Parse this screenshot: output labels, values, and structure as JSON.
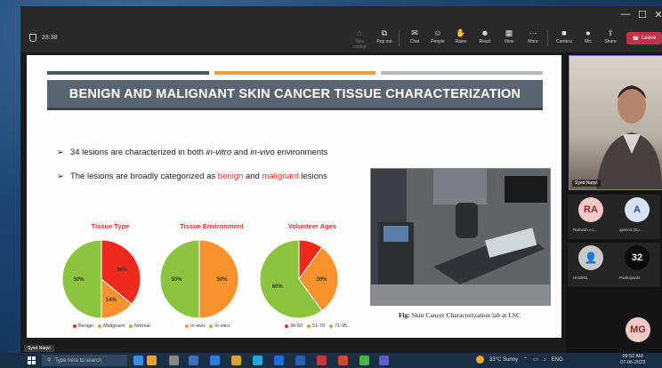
{
  "titlebar": {
    "minimize": "—",
    "maximize": "☐",
    "close": "✕"
  },
  "meeting": {
    "timer": "28:38",
    "toolbar": [
      {
        "label": "Take control",
        "icon": "take-control-icon",
        "dim": true
      },
      {
        "label": "Pop out",
        "icon": "pop-out-icon",
        "dim": false
      },
      {
        "label": "Chat",
        "icon": "chat-icon",
        "dim": false
      },
      {
        "label": "People",
        "icon": "people-icon",
        "dim": false
      },
      {
        "label": "Raise",
        "icon": "raise-hand-icon",
        "dim": false
      },
      {
        "label": "React",
        "icon": "react-icon",
        "dim": false
      },
      {
        "label": "View",
        "icon": "view-icon",
        "dim": false
      },
      {
        "label": "More",
        "icon": "more-icon",
        "dim": false
      },
      {
        "label": "Camera",
        "icon": "camera-icon",
        "dim": false
      },
      {
        "label": "Mic",
        "icon": "mic-icon",
        "dim": false
      },
      {
        "label": "Share",
        "icon": "share-icon",
        "dim": false
      }
    ],
    "leave_label": "Leave"
  },
  "slide": {
    "title": "BENIGN AND MALIGNANT SKIN CANCER TISSUE CHARACTERIZATION",
    "bullet1_a": "34 lesions are characterized in both ",
    "bullet1_b": "in-vitro",
    "bullet1_c": " and ",
    "bullet1_d": "in-vivo",
    "bullet1_e": " environments",
    "bullet2_a": "The lesions are broadly categorized as ",
    "bullet2_b": "benign",
    "bullet2_c": " and ",
    "bullet2_d": "malignant",
    "bullet2_e": " lesions",
    "caption_bold": "Fig:",
    "caption_rest": " Skin Cancer Characterization lab at LSC",
    "colors": {
      "red": "#ee2a1c",
      "orange": "#f8932c",
      "green": "#8cc43f",
      "bar_dark": "#4a545e",
      "bar_orange": "#f39a3a",
      "bar_gray": "#b5b9be"
    }
  },
  "chart_data": [
    {
      "type": "pie",
      "title": "Tissue Type",
      "categories": [
        "Benign",
        "Malignant",
        "Normal"
      ],
      "values": [
        36,
        14,
        50
      ],
      "value_labels": [
        "36%",
        "14%",
        "50%"
      ],
      "colors": [
        "#ee2a1c",
        "#f8932c",
        "#8cc43f"
      ],
      "legend_markers": [
        "#ee2a1c",
        "#f8932c",
        "#8cc43f"
      ],
      "legend_placement": "bottom"
    },
    {
      "type": "pie",
      "title": "Tissue Environment",
      "categories": [
        "In-vivo",
        "In-vitro"
      ],
      "values": [
        50,
        50
      ],
      "value_labels": [
        "50%",
        "50%"
      ],
      "colors": [
        "#f8932c",
        "#8cc43f"
      ],
      "legend_markers": [
        "#f8932c",
        "#8cc43f"
      ],
      "legend_placement": "bottom"
    },
    {
      "type": "pie",
      "title": "Volunteer Ages",
      "categories": [
        "30-50",
        "51-70",
        "71-95"
      ],
      "values": [
        10,
        30,
        60
      ],
      "value_labels": [
        "",
        "30%",
        "60%"
      ],
      "colors": [
        "#ee2a1c",
        "#f8932c",
        "#8cc43f"
      ],
      "legend_markers": [
        "#ee2a1c",
        "#f8932c",
        "#8cc43f"
      ],
      "legend_placement": "bottom"
    }
  ],
  "participants": {
    "speaker_name": "Syed Naqvi",
    "tiles": [
      {
        "initials": "RA",
        "name": "Ramesh A (...",
        "bg": "#f1c9c7",
        "fg": "#8a2b2b"
      },
      {
        "initials": "A",
        "name": "aparna (Gu...",
        "bg": "#d6e2f3",
        "fg": "#2c4a77"
      },
      {
        "initials": "",
        "name": "HH2991",
        "bg": "#c9c9c9",
        "fg": "#333",
        "icon": "person-icon"
      },
      {
        "initials": "32",
        "name": "Participants",
        "bg": "#0b0b0b",
        "fg": "#fff"
      }
    ],
    "bottom_initials": "MG"
  },
  "presenter_label": "Syed Naqvi",
  "taskbar": {
    "search_placeholder": "Type here to search",
    "weather": "33°C  Sunny",
    "lang": "ENG",
    "time": "09:52 AM",
    "date": "07-06-2023"
  }
}
